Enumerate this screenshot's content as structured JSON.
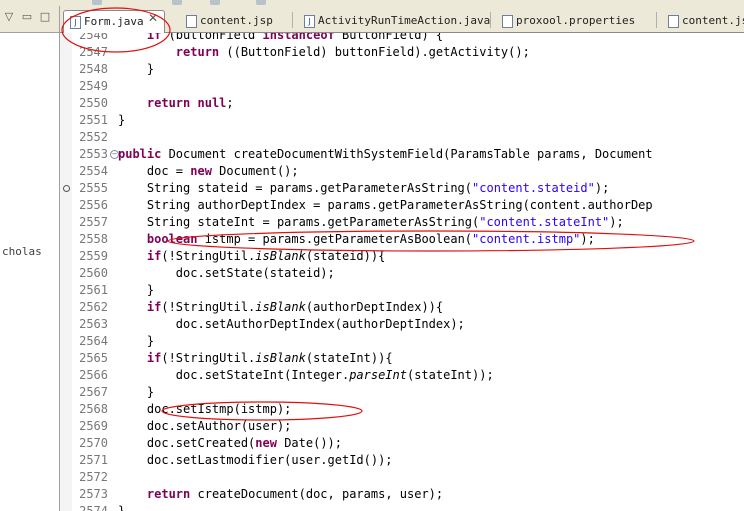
{
  "left_panel": {
    "tree_item": "cholas"
  },
  "tabs": [
    {
      "label": "Form.java",
      "icon": "J",
      "active": true,
      "close": "✕"
    },
    {
      "label": "content.jsp",
      "icon": "",
      "active": false
    },
    {
      "label": "ActivityRunTimeAction.java",
      "icon": "J",
      "active": false
    },
    {
      "label": "proxool.properties",
      "icon": "",
      "active": false
    },
    {
      "label": "content.jsp",
      "icon": "",
      "active": false
    }
  ],
  "code_lines": [
    {
      "num": "2546",
      "text": "    if (buttonField instanceof ButtonField) {"
    },
    {
      "num": "2547",
      "text": "        return ((ButtonField) buttonField).getActivity();"
    },
    {
      "num": "2548",
      "text": "    }"
    },
    {
      "num": "2549",
      "text": ""
    },
    {
      "num": "2550",
      "text": "    return null;"
    },
    {
      "num": "2551",
      "text": "}"
    },
    {
      "num": "2552",
      "text": ""
    },
    {
      "num": "2553",
      "text": "public Document createDocumentWithSystemField(ParamsTable params, Document"
    },
    {
      "num": "2554",
      "text": "    doc = new Document();"
    },
    {
      "num": "2555",
      "text": "    String stateid = params.getParameterAsString(\"content.stateid\");"
    },
    {
      "num": "2556",
      "text": "    String authorDeptIndex = params.getParameterAsString(\"content.authorDep"
    },
    {
      "num": "2557",
      "text": "    String stateInt = params.getParameterAsString(\"content.stateInt\");"
    },
    {
      "num": "2558",
      "text": "    boolean istmp = params.getParameterAsBoolean(\"content.istmp\");"
    },
    {
      "num": "2559",
      "text": "    if(!StringUtil.isBlank(stateid)){"
    },
    {
      "num": "2560",
      "text": "        doc.setState(stateid);"
    },
    {
      "num": "2561",
      "text": "    }"
    },
    {
      "num": "2562",
      "text": "    if(!StringUtil.isBlank(authorDeptIndex)){"
    },
    {
      "num": "2563",
      "text": "        doc.setAuthorDeptIndex(authorDeptIndex);"
    },
    {
      "num": "2564",
      "text": "    }"
    },
    {
      "num": "2565",
      "text": "    if(!StringUtil.isBlank(stateInt)){"
    },
    {
      "num": "2566",
      "text": "        doc.setStateInt(Integer.parseInt(stateInt));"
    },
    {
      "num": "2567",
      "text": "    }"
    },
    {
      "num": "2568",
      "text": "    doc.setIstmp(istmp);"
    },
    {
      "num": "2569",
      "text": "    doc.setAuthor(user);"
    },
    {
      "num": "2570",
      "text": "    doc.setCreated(new Date());"
    },
    {
      "num": "2571",
      "text": "    doc.setLastmodifier(user.getId());"
    },
    {
      "num": "2572",
      "text": ""
    },
    {
      "num": "2573",
      "text": "    return createDocument(doc, params, user);"
    },
    {
      "num": "2574",
      "text": "}"
    }
  ],
  "colors": {
    "keyword": "#7f0055",
    "string": "#2a00ff",
    "annotation": "#e01010",
    "line_number": "#787878"
  }
}
